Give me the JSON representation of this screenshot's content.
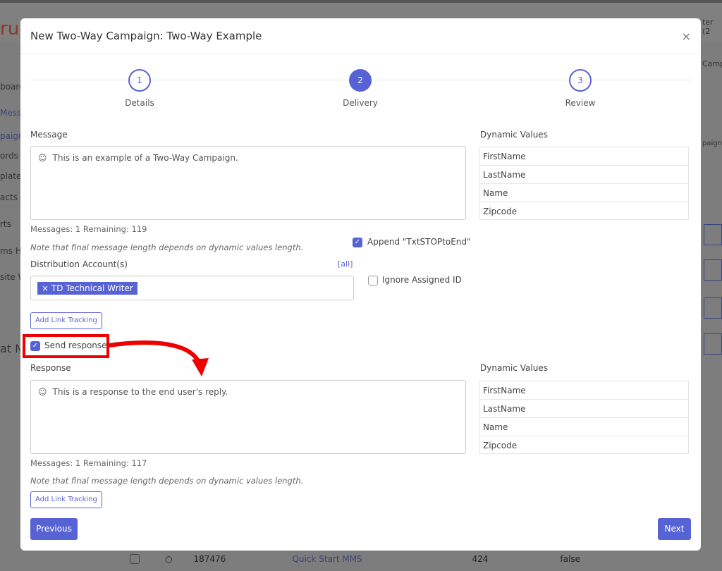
{
  "background": {
    "logo": "rue",
    "side_items": [
      "board",
      "Mess",
      "paigns",
      "ords",
      "plates",
      "acts",
      "rts",
      "ms He",
      "site W",
      "at N"
    ],
    "right_text": [
      "ter (2",
      "Camp",
      "paign"
    ],
    "row": {
      "id": "187476",
      "name": "Quick Start MMS",
      "count": "424",
      "flag": "false"
    }
  },
  "modal": {
    "title": "New Two-Way Campaign: Two-Way Example",
    "close": "×",
    "steps": [
      {
        "num": "1",
        "label": "Details"
      },
      {
        "num": "2",
        "label": "Delivery"
      },
      {
        "num": "3",
        "label": "Review"
      }
    ],
    "message": {
      "label": "Message",
      "value": "This is an example of a Two-Way Campaign.",
      "counter": "Messages: 1 Remaining: 119",
      "note": "Note that final message length depends on dynamic values length."
    },
    "dynamic_label": "Dynamic Values",
    "dynamic_values": [
      "FirstName",
      "LastName",
      "Name",
      "Zipcode"
    ],
    "append": {
      "label": "Append \"TxtSTOPtoEnd\"",
      "checked": true
    },
    "distribution": {
      "label": "Distribution Account(s)",
      "all": "[all]",
      "tag": "× TD Technical Writer"
    },
    "ignore": {
      "label": "Ignore Assigned ID",
      "checked": false
    },
    "add_link": "Add Link Tracking",
    "send_response": {
      "label": "Send response",
      "checked": true
    },
    "response": {
      "label": "Response",
      "value": "This is a response to the end user's reply.",
      "counter": "Messages: 1 Remaining: 117",
      "note": "Note that final message length depends on dynamic values length."
    },
    "previous": "Previous",
    "next": "Next"
  },
  "colors": {
    "accent": "#5763d4",
    "highlight": "#e00000"
  }
}
